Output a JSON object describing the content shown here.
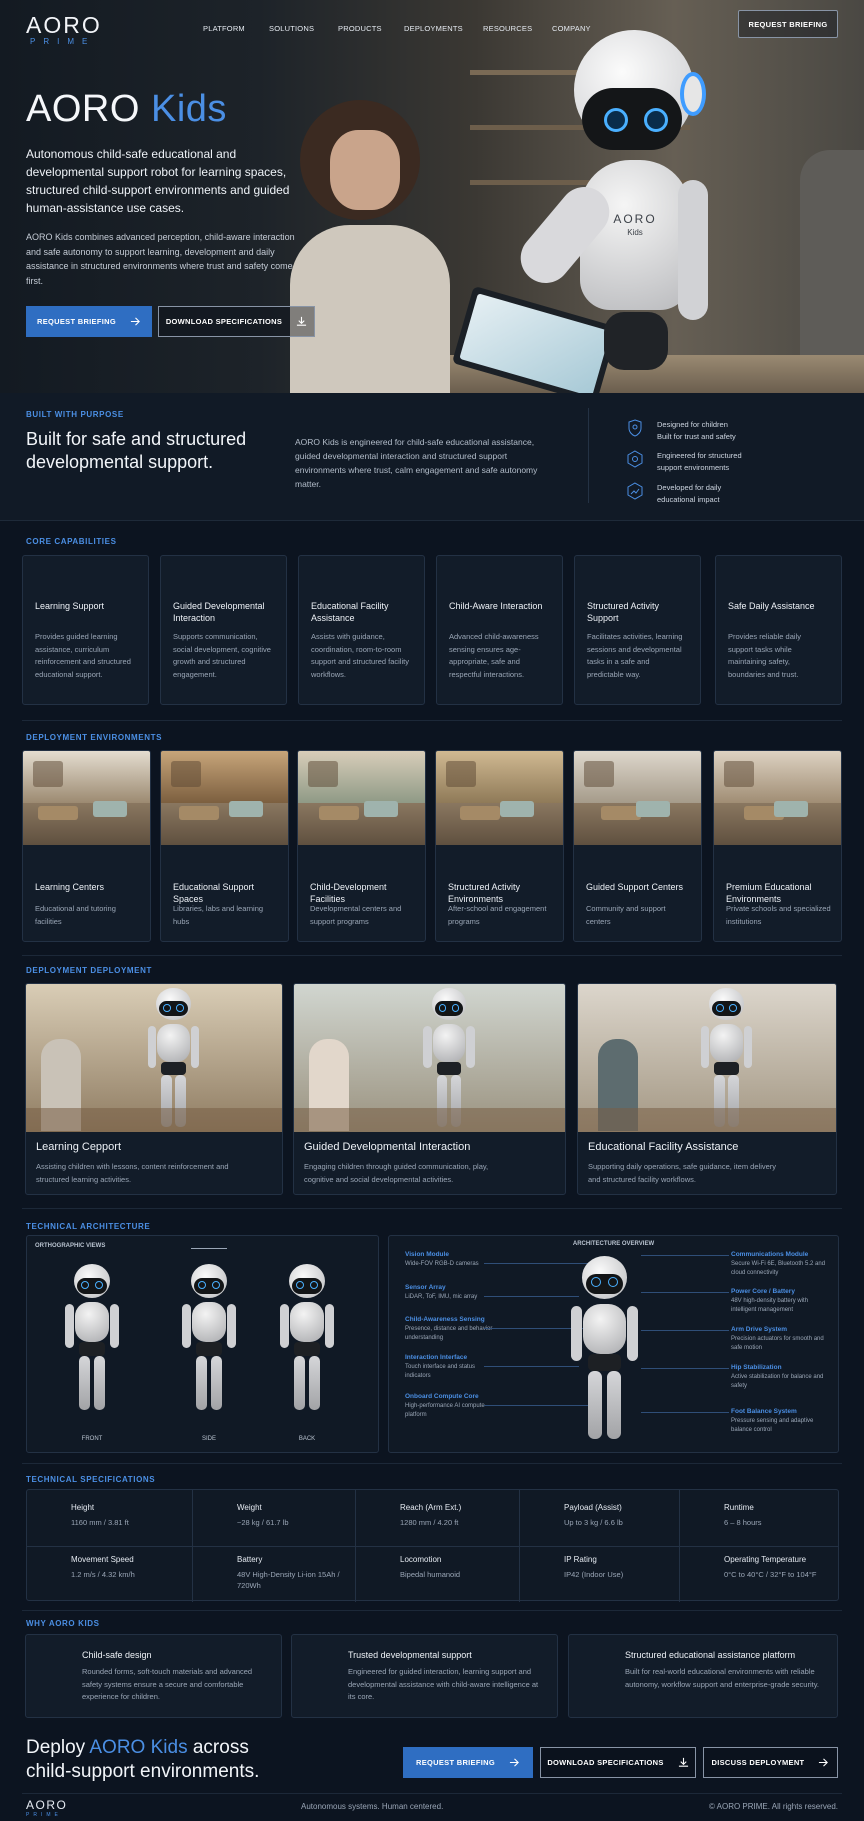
{
  "brand": {
    "name": "AORO",
    "sub": "PRIME"
  },
  "nav": {
    "items": [
      "PLATFORM",
      "SOLUTIONS",
      "PRODUCTS",
      "DEPLOYMENTS",
      "RESOURCES",
      "COMPANY"
    ],
    "active": "PRODUCTS",
    "cta": "REQUEST BRIEFING"
  },
  "hero": {
    "title_a": "AORO",
    "title_b": "Kids",
    "lead": "Autonomous child-safe educational and developmental support robot for learning spaces, structured child-support environments and guided human-assistance use cases.",
    "body": "AORO Kids combines advanced perception, child-aware interaction and safe autonomy to support learning, development and daily assistance in structured environments where trust and safety come first.",
    "btn_primary": "REQUEST BRIEFING",
    "btn_secondary": "DOWNLOAD SPECIFICATIONS",
    "robot_badge": "AORO",
    "robot_badge_sub": "Kids"
  },
  "purpose": {
    "label": "BUILT WITH PURPOSE",
    "title": "Built for safe and structured developmental support.",
    "text": "AORO Kids is engineered for child-safe educational assistance, guided developmental interaction and structured support environments where trust, calm engagement and safe autonomy matter.",
    "points": [
      {
        "line1": "Designed for children",
        "line2": "Built for trust and safety",
        "icon": "shield-child-icon"
      },
      {
        "line1": "Engineered for structured",
        "line2": "support environments",
        "icon": "hexagon-gear-icon"
      },
      {
        "line1": "Developed for daily",
        "line2": "educational impact",
        "icon": "growth-icon"
      }
    ]
  },
  "capabilities": {
    "label": "CORE CAPABILITIES",
    "items": [
      {
        "title": "Learning Support",
        "text": "Provides guided learning assistance, curriculum reinforcement and structured educational support.",
        "icon": "book-icon"
      },
      {
        "title": "Guided Developmental Interaction",
        "text": "Supports communication, social development, cognitive growth and structured engagement.",
        "icon": "people-icon"
      },
      {
        "title": "Educational Facility Assistance",
        "text": "Assists with guidance, coordination, room-to-room support and structured facility workflows.",
        "icon": "building-icon"
      },
      {
        "title": "Child-Aware Interaction",
        "text": "Advanced child-awareness sensing ensures age-appropriate, safe and respectful interactions.",
        "icon": "shield-person-icon"
      },
      {
        "title": "Structured Activity Support",
        "text": "Facilitates activities, learning sessions and developmental tasks in a safe and predictable way.",
        "icon": "blocks-icon"
      },
      {
        "title": "Safe Daily Assistance",
        "text": "Provides reliable daily support tasks while maintaining safety, boundaries and trust.",
        "icon": "shield-check-icon"
      }
    ]
  },
  "environments": {
    "label": "DEPLOYMENT ENVIRONMENTS",
    "items": [
      {
        "title": "Learning Centers",
        "text": "Educational and tutoring facilities",
        "icon": "school-icon"
      },
      {
        "title": "Educational Support Spaces",
        "text": "Libraries, labs and learning hubs",
        "icon": "library-icon"
      },
      {
        "title": "Child-Development Facilities",
        "text": "Developmental centers and support programs",
        "icon": "child-icon"
      },
      {
        "title": "Structured Activity Environments",
        "text": "After-school and engagement programs",
        "icon": "activity-icon"
      },
      {
        "title": "Guided Support Centers",
        "text": "Community and support centers",
        "icon": "support-icon"
      },
      {
        "title": "Premium Educational Environments",
        "text": "Private schools and specialized institutions",
        "icon": "premium-icon"
      }
    ]
  },
  "deployment": {
    "label": "DEPLOYMENT DEPLOYMENT",
    "items": [
      {
        "title": "Learning Cepport",
        "text": "Assisting children with lessons, content reinforcement and structured learning activities."
      },
      {
        "title": "Guided Developmental Interaction",
        "text": "Engaging children through guided communication, play, cognitive and social developmental activities."
      },
      {
        "title": "Educational Facility Assistance",
        "text": "Supporting daily operations, safe guidance, item delivery and structured facility workflows."
      }
    ]
  },
  "architecture": {
    "label": "TECHNICAL ARCHITECTURE",
    "ortho_label": "ORTHOGRAPHIC VIEWS",
    "views": [
      "FRONT",
      "SIDE",
      "BACK"
    ],
    "overview_label": "ARCHITECTURE OVERVIEW",
    "left": [
      {
        "title": "Vision Module",
        "text": "Wide-FOV RGB-D cameras"
      },
      {
        "title": "Sensor Array",
        "text": "LiDAR, ToF, IMU, mic array"
      },
      {
        "title": "Child-Awareness Sensing",
        "text": "Presence, distance and behavior understanding"
      },
      {
        "title": "Interaction Interface",
        "text": "Touch interface and status indicators"
      },
      {
        "title": "Onboard Compute Core",
        "text": "High-performance AI compute platform"
      }
    ],
    "right": [
      {
        "title": "Communications Module",
        "text": "Secure Wi-Fi 6E, Bluetooth 5.2 and cloud connectivity"
      },
      {
        "title": "Power Core / Battery",
        "text": "48V high-density battery with intelligent management"
      },
      {
        "title": "Arm Drive System",
        "text": "Precision actuators for smooth and safe motion"
      },
      {
        "title": "Hip Stabilization",
        "text": "Active stabilization for balance and safety"
      },
      {
        "title": "Foot Balance System",
        "text": "Pressure sensing and adaptive balance control"
      }
    ]
  },
  "specs": {
    "label": "TECHNICAL SPECIFICATIONS",
    "items": [
      {
        "label": "Height",
        "value": "1160 mm / 3.81 ft",
        "icon": "document-icon"
      },
      {
        "label": "Weight",
        "value": "~28 kg / 61.7 lb",
        "icon": "weight-icon"
      },
      {
        "label": "Reach (Arm Ext.)",
        "value": "1280 mm / 4.20 ft",
        "icon": "reach-icon"
      },
      {
        "label": "Payload (Assist)",
        "value": "Up to 3 kg / 6.6 lb",
        "icon": "payload-icon"
      },
      {
        "label": "Runtime",
        "value": "6 – 8 hours",
        "icon": "clock-icon"
      },
      {
        "label": "Movement Speed",
        "value": "1.2 m/s / 4.32 km/h",
        "icon": "speed-icon"
      },
      {
        "label": "Battery",
        "value": "48V High-Density Li-ion 15Ah / 720Wh",
        "icon": "battery-icon"
      },
      {
        "label": "Locomotion",
        "value": "Bipedal humanoid",
        "icon": "locomotion-icon"
      },
      {
        "label": "IP Rating",
        "value": "IP42 (Indoor Use)",
        "icon": "ip-shield-icon"
      },
      {
        "label": "Operating Temperature",
        "value": "0°C to 40°C / 32°F to 104°F",
        "icon": "thermometer-icon"
      }
    ]
  },
  "why": {
    "label": "WHY AORO KIDS",
    "items": [
      {
        "title": "Child-safe design",
        "text": "Rounded forms, soft-touch materials and advanced safety systems ensure a secure and comfortable experience for children.",
        "icon": "child-safe-icon"
      },
      {
        "title": "Trusted developmental support",
        "text": "Engineered for guided interaction, learning support and developmental assistance with child-aware intelligence at its core.",
        "icon": "head-brain-icon"
      },
      {
        "title": "Structured educational assistance platform",
        "text": "Built for real-world educational environments with reliable autonomy, workflow support and enterprise-grade security.",
        "icon": "platform-icon"
      }
    ]
  },
  "cta": {
    "title_a": "Deploy ",
    "title_b": "AORO Kids",
    "title_c": " across",
    "title_d": "child-support environments.",
    "btn1": "REQUEST BRIEFING",
    "btn2": "DOWNLOAD SPECIFICATIONS",
    "btn3": "DISCUSS DEPLOYMENT"
  },
  "footer": {
    "tagline": "Autonomous systems. Human centered.",
    "copyright": "© AORO PRIME. All rights reserved."
  },
  "colors": {
    "accent": "#4b8fe4",
    "button": "#2f6ec2",
    "background": "#0c1420",
    "card": "#121c29"
  }
}
